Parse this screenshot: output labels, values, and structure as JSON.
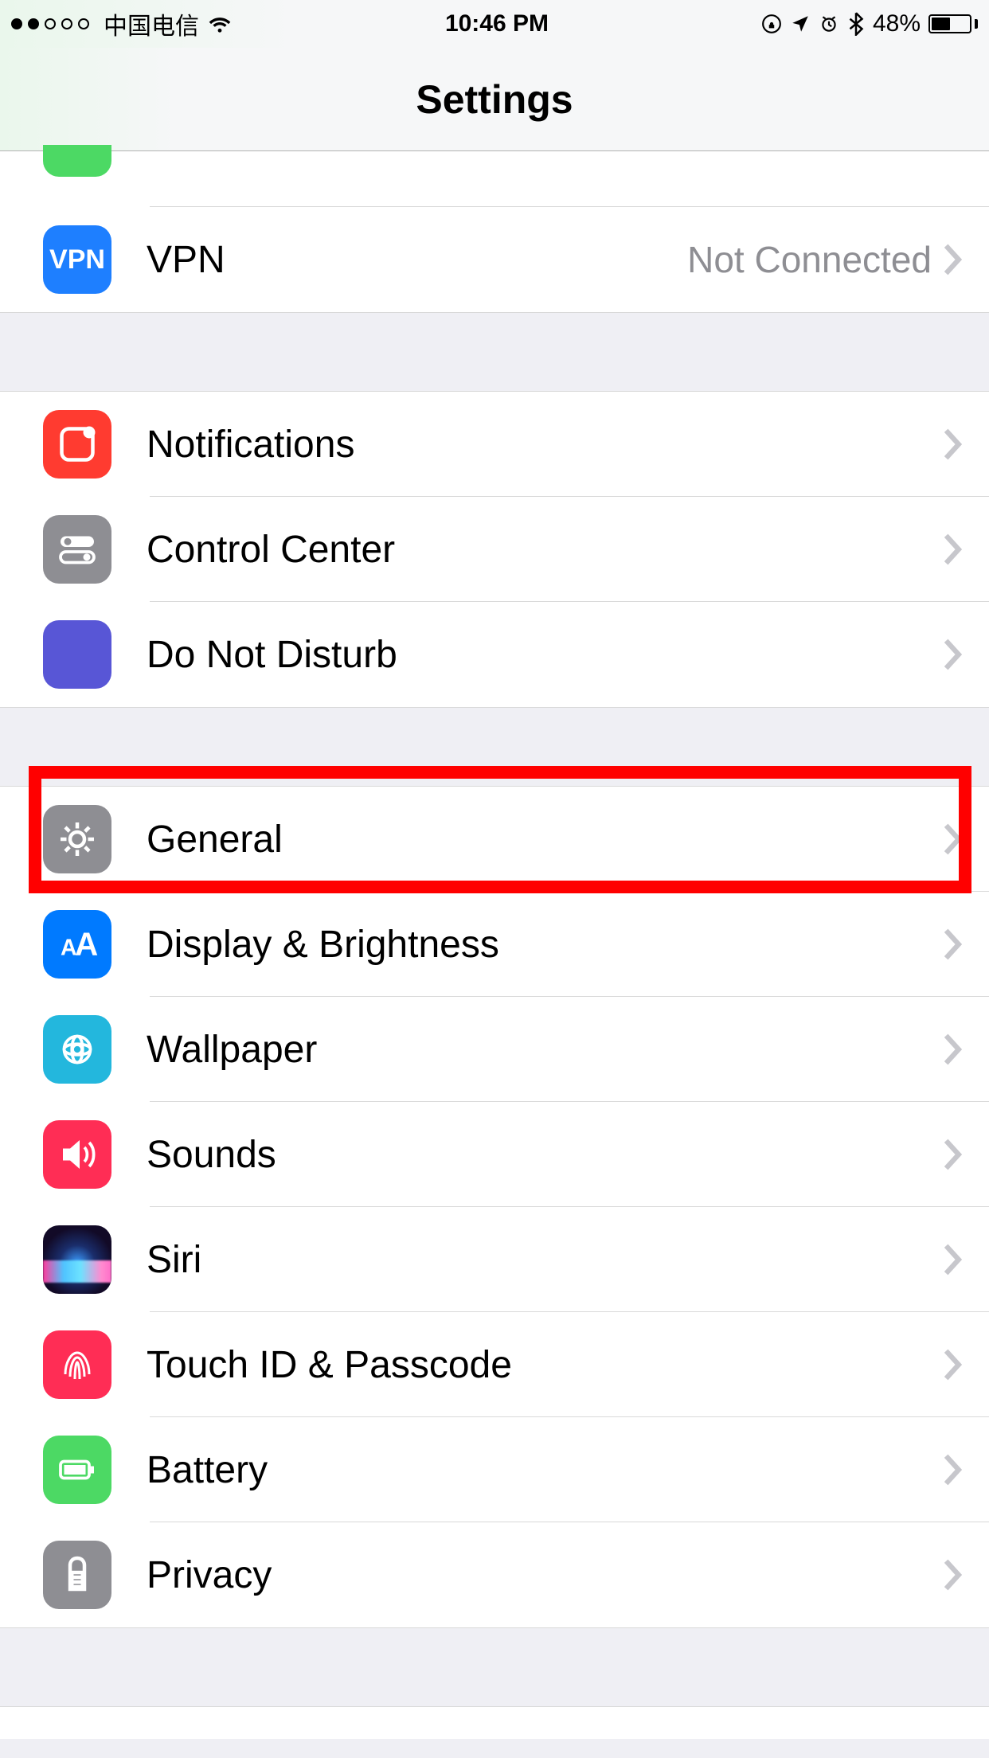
{
  "status": {
    "carrier": "中国电信",
    "time": "10:46 PM",
    "battery_pct": "48%"
  },
  "nav": {
    "title": "Settings"
  },
  "rows": {
    "vpn": {
      "label": "VPN",
      "detail": "Not Connected",
      "icon_text": "VPN"
    },
    "notifications": {
      "label": "Notifications"
    },
    "controlcenter": {
      "label": "Control Center"
    },
    "dnd": {
      "label": "Do Not Disturb"
    },
    "general": {
      "label": "General"
    },
    "display": {
      "label": "Display & Brightness"
    },
    "wallpaper": {
      "label": "Wallpaper"
    },
    "sounds": {
      "label": "Sounds"
    },
    "siri": {
      "label": "Siri"
    },
    "touchid": {
      "label": "Touch ID & Passcode"
    },
    "battery": {
      "label": "Battery"
    },
    "privacy": {
      "label": "Privacy"
    }
  }
}
